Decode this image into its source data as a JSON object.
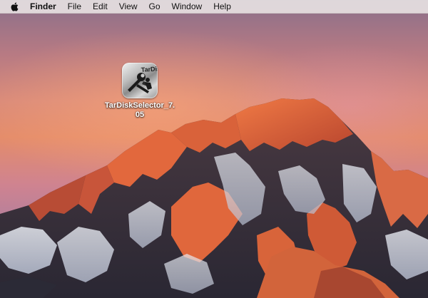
{
  "menubar": {
    "apple_icon": "apple-logo-icon",
    "app_name": "Finder",
    "items": [
      "File",
      "Edit",
      "View",
      "Go",
      "Window",
      "Help"
    ]
  },
  "desktop": {
    "wallpaper": "Sierra mountain at sunset",
    "icons": [
      {
        "label": "TarDiskSelector_7.05",
        "label_line1": "TarDiskSelector_7.",
        "label_line2": "05",
        "icon_text": "TarDisk",
        "icon": "tardisk-app-icon"
      }
    ]
  },
  "colors": {
    "menubar_bg": "#ece8e8",
    "label_text": "#ffffff",
    "sky_top": "#8a6f8a",
    "sky_mid": "#e48c6a",
    "peak_light": "#e0673c",
    "rock_dark": "#3a3340",
    "snow": "#dfe3ee"
  }
}
